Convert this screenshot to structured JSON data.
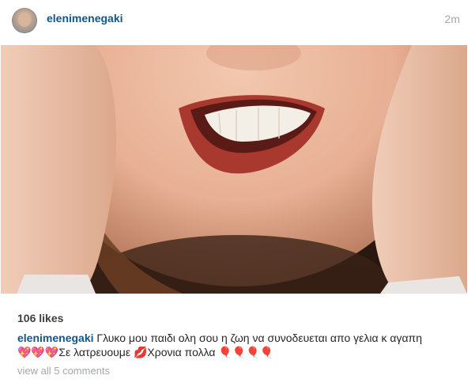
{
  "post": {
    "username": "elenimenegaki",
    "timestamp": "2m",
    "photo_alt": "",
    "likes": "106 likes",
    "caption_user": "elenimenegaki",
    "caption_line1": "Γλυκο μου παιδι ολη σου η ζωη να συνοδευεται απο γελια κ αγαπη",
    "caption_line2": "💖💖💖Σε λατρευουμε 💋Χρονια πολλα 🎈🎈🎈🎈",
    "view_comments": "view all 5 comments"
  },
  "icons": {
    "avatar": "profile-avatar"
  },
  "colors": {
    "username": "#125688",
    "muted": "#a5a7aa",
    "text": "#262626",
    "likes": "#3f3f3f"
  }
}
